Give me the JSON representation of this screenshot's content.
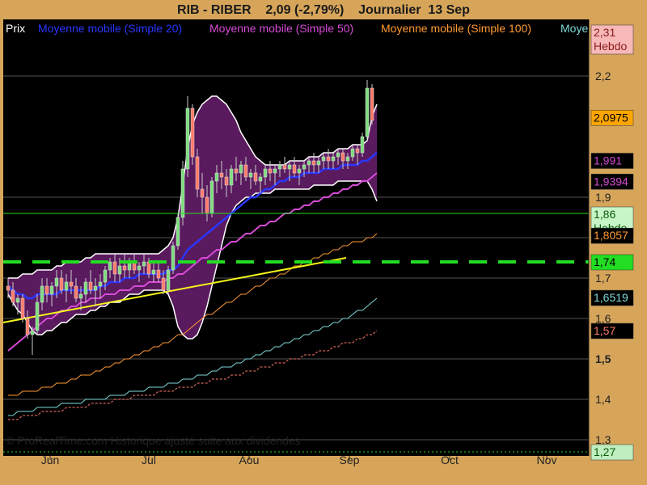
{
  "header": {
    "title": "RIB - RIBER    2,09 (-2,79%)    Journalier  13 Sep"
  },
  "legend": [
    {
      "label": "Prix",
      "color": "#ffffff"
    },
    {
      "label": "Moyenne mobile (Simple 20)",
      "color": "#2a36ff"
    },
    {
      "label": "Moyenne mobile (Simple 50)",
      "color": "#d64bd6"
    },
    {
      "label": "Moyenne mobile (Simple 100)",
      "color": "#ff9a33"
    },
    {
      "label": "Moye",
      "color": "#7fd8d8"
    }
  ],
  "footer": {
    "copyright": "© ProRealTime.com Historique ajusté suite aux dividendes"
  },
  "colors": {
    "background": "#000000",
    "frame": "#d6a55a",
    "bollinger_fill": "#5a1a5e",
    "candle_up": "#7fdc7f",
    "candle_down": "#ff7a6a",
    "sma20": "#2a36ff",
    "sma50": "#d64bd6",
    "sma100": "#ff9a33",
    "sma200": "#7fd8d8",
    "trendline": "#f5f51a",
    "support": "#22dd22"
  },
  "chart_data": {
    "type": "candlestick",
    "x_ticks": [
      "Jun",
      "Jul",
      "Aou",
      "Sep",
      "Oct",
      "Nov"
    ],
    "y_ticks": [
      "2,2",
      "1,9",
      "1,8",
      "1,7",
      "1,6",
      "1,5",
      "1,4",
      "1,3"
    ],
    "y_tick_bold": "1,5",
    "ylim": [
      1.26,
      2.34
    ],
    "price_labels": [
      {
        "value": 2.31,
        "text": "2,31\nHebdo",
        "bg": "#f7b8b8",
        "fg": "#8b1a1a"
      },
      {
        "value": 2.0975,
        "text": "2,0975",
        "bg": "#ffa500",
        "fg": "#000000"
      },
      {
        "value": 1.991,
        "text": "1,991",
        "bg": "#000000",
        "fg": "#d64bd6"
      },
      {
        "value": 1.9394,
        "text": "1,9394",
        "bg": "#000000",
        "fg": "#d64bd6"
      },
      {
        "value": 1.86,
        "text": "1,86\nHebdo",
        "bg": "#c8f5c8",
        "fg": "#0b5a0b"
      },
      {
        "value": 1.8057,
        "text": "1,8057",
        "bg": "#000000",
        "fg": "#ff9a33"
      },
      {
        "value": 1.74,
        "text": "1,74",
        "bg": "#22dd22",
        "fg": "#000000"
      },
      {
        "value": 1.6519,
        "text": "1,6519",
        "bg": "#000000",
        "fg": "#7fd8d8"
      },
      {
        "value": 1.57,
        "text": "1,57",
        "bg": "#000000",
        "fg": "#ff7a6a"
      },
      {
        "value": 1.27,
        "text": "1,27",
        "bg": "#bfeec0",
        "fg": "#0b5a0b"
      }
    ],
    "horizontal_lines": [
      {
        "value": 2.31,
        "style": "solid",
        "color": "#ff0000"
      },
      {
        "value": 1.86,
        "style": "solid",
        "color": "#22dd22"
      },
      {
        "value": 1.74,
        "style": "dashed",
        "color": "#22dd22"
      },
      {
        "value": 1.27,
        "style": "dotted",
        "color": "#22dd22"
      }
    ],
    "candles": [
      [
        "o",
        1.68,
        1.7,
        1.65,
        1.67
      ],
      [
        "o",
        1.67,
        1.69,
        1.63,
        1.64
      ],
      [
        "o",
        1.64,
        1.66,
        1.61,
        1.65
      ],
      [
        "o",
        1.65,
        1.66,
        1.59,
        1.6
      ],
      [
        "o",
        1.6,
        1.62,
        1.55,
        1.56
      ],
      [
        "o",
        1.56,
        1.58,
        1.51,
        1.57
      ],
      [
        "o",
        1.57,
        1.66,
        1.56,
        1.64
      ],
      [
        "o",
        1.64,
        1.7,
        1.62,
        1.68
      ],
      [
        "o",
        1.68,
        1.7,
        1.64,
        1.66
      ],
      [
        "o",
        1.66,
        1.69,
        1.63,
        1.68
      ],
      [
        "o",
        1.68,
        1.72,
        1.65,
        1.7
      ],
      [
        "o",
        1.7,
        1.72,
        1.66,
        1.67
      ],
      [
        "o",
        1.67,
        1.71,
        1.64,
        1.69
      ],
      [
        "o",
        1.69,
        1.72,
        1.66,
        1.68
      ],
      [
        "o",
        1.68,
        1.7,
        1.64,
        1.65
      ],
      [
        "o",
        1.65,
        1.68,
        1.62,
        1.66
      ],
      [
        "o",
        1.66,
        1.7,
        1.64,
        1.69
      ],
      [
        "o",
        1.69,
        1.72,
        1.66,
        1.67
      ],
      [
        "o",
        1.67,
        1.7,
        1.63,
        1.68
      ],
      [
        "o",
        1.68,
        1.71,
        1.65,
        1.69
      ],
      [
        "o",
        1.69,
        1.73,
        1.67,
        1.72
      ],
      [
        "o",
        1.72,
        1.75,
        1.7,
        1.74
      ],
      [
        "o",
        1.74,
        1.76,
        1.69,
        1.71
      ],
      [
        "o",
        1.71,
        1.75,
        1.69,
        1.73
      ],
      [
        "o",
        1.73,
        1.76,
        1.7,
        1.72
      ],
      [
        "o",
        1.72,
        1.75,
        1.7,
        1.74
      ],
      [
        "o",
        1.74,
        1.76,
        1.71,
        1.72
      ],
      [
        "o",
        1.72,
        1.74,
        1.69,
        1.73
      ],
      [
        "o",
        1.73,
        1.76,
        1.71,
        1.74
      ],
      [
        "o",
        1.74,
        1.75,
        1.7,
        1.71
      ],
      [
        "o",
        1.71,
        1.74,
        1.69,
        1.72
      ],
      [
        "o",
        1.72,
        1.74,
        1.69,
        1.7
      ],
      [
        "o",
        1.7,
        1.72,
        1.66,
        1.67
      ],
      [
        "o",
        1.67,
        1.73,
        1.66,
        1.72
      ],
      [
        "o",
        1.72,
        1.79,
        1.71,
        1.78
      ],
      [
        "o",
        1.78,
        1.86,
        1.77,
        1.85
      ],
      [
        "o",
        1.85,
        1.99,
        1.83,
        1.97
      ],
      [
        "o",
        1.97,
        2.15,
        1.95,
        2.12
      ],
      [
        "o",
        2.12,
        2.13,
        1.98,
        2.0
      ],
      [
        "o",
        2.0,
        2.02,
        1.9,
        1.92
      ],
      [
        "o",
        1.92,
        1.96,
        1.86,
        1.9
      ],
      [
        "o",
        1.9,
        1.93,
        1.84,
        1.86
      ],
      [
        "o",
        1.86,
        1.95,
        1.85,
        1.94
      ],
      [
        "o",
        1.94,
        1.98,
        1.91,
        1.96
      ],
      [
        "o",
        1.96,
        1.99,
        1.92,
        1.95
      ],
      [
        "o",
        1.95,
        1.97,
        1.9,
        1.93
      ],
      [
        "o",
        1.93,
        1.98,
        1.91,
        1.97
      ],
      [
        "o",
        1.97,
        2.0,
        1.94,
        1.96
      ],
      [
        "o",
        1.96,
        1.99,
        1.93,
        1.98
      ],
      [
        "o",
        1.98,
        2.0,
        1.94,
        1.95
      ],
      [
        "o",
        1.95,
        1.97,
        1.92,
        1.96
      ],
      [
        "o",
        1.96,
        1.98,
        1.93,
        1.94
      ],
      [
        "o",
        1.94,
        1.96,
        1.91,
        1.95
      ],
      [
        "o",
        1.95,
        1.98,
        1.93,
        1.97
      ],
      [
        "o",
        1.97,
        1.99,
        1.94,
        1.96
      ],
      [
        "o",
        1.96,
        1.98,
        1.93,
        1.97
      ],
      [
        "o",
        1.97,
        1.99,
        1.95,
        1.98
      ],
      [
        "o",
        1.98,
        2.0,
        1.96,
        1.97
      ],
      [
        "o",
        1.97,
        1.99,
        1.94,
        1.98
      ],
      [
        "o",
        1.98,
        2.0,
        1.95,
        1.96
      ],
      [
        "o",
        1.96,
        1.98,
        1.93,
        1.97
      ],
      [
        "o",
        1.97,
        1.99,
        1.95,
        1.98
      ],
      [
        "o",
        1.98,
        2.0,
        1.96,
        1.99
      ],
      [
        "o",
        1.99,
        2.01,
        1.96,
        1.98
      ],
      [
        "o",
        1.98,
        2.0,
        1.96,
        1.99
      ],
      [
        "o",
        1.99,
        2.01,
        1.97,
        2.0
      ],
      [
        "o",
        2.0,
        2.02,
        1.97,
        1.99
      ],
      [
        "o",
        1.99,
        2.01,
        1.97,
        2.0
      ],
      [
        "o",
        2.0,
        2.02,
        1.98,
        2.01
      ],
      [
        "o",
        2.01,
        2.02,
        1.97,
        1.99
      ],
      [
        "o",
        1.99,
        2.01,
        1.97,
        2.0
      ],
      [
        "o",
        2.0,
        2.03,
        1.99,
        2.02
      ],
      [
        "o",
        2.02,
        2.03,
        1.98,
        2.01
      ],
      [
        "o",
        2.01,
        2.06,
        2.0,
        2.05
      ],
      [
        "o",
        2.05,
        2.19,
        2.04,
        2.17
      ],
      [
        "o",
        2.17,
        2.18,
        2.08,
        2.09
      ]
    ],
    "series": [
      {
        "name": "Moyenne mobile (Simple 20)",
        "values": [
          1.68,
          1.67,
          1.66,
          1.66,
          1.65,
          1.65,
          1.66,
          1.66,
          1.66,
          1.66,
          1.66,
          1.67,
          1.67,
          1.67,
          1.67,
          1.67,
          1.67,
          1.67,
          1.67,
          1.68,
          1.68,
          1.69,
          1.69,
          1.69,
          1.7,
          1.7,
          1.7,
          1.71,
          1.71,
          1.71,
          1.71,
          1.71,
          1.71,
          1.72,
          1.72,
          1.73,
          1.75,
          1.77,
          1.78,
          1.79,
          1.8,
          1.81,
          1.82,
          1.83,
          1.84,
          1.85,
          1.86,
          1.87,
          1.88,
          1.89,
          1.9,
          1.9,
          1.91,
          1.92,
          1.92,
          1.93,
          1.94,
          1.94,
          1.95,
          1.95,
          1.95,
          1.96,
          1.96,
          1.96,
          1.96,
          1.97,
          1.97,
          1.97,
          1.97,
          1.98,
          1.98,
          1.98,
          1.98,
          1.99,
          1.99,
          2.0,
          2.01
        ]
      },
      {
        "name": "Moyenne mobile (Simple 50)",
        "values": [
          1.52,
          1.53,
          1.54,
          1.55,
          1.56,
          1.57,
          1.58,
          1.59,
          1.6,
          1.6,
          1.61,
          1.62,
          1.62,
          1.63,
          1.63,
          1.64,
          1.64,
          1.65,
          1.65,
          1.65,
          1.66,
          1.66,
          1.66,
          1.67,
          1.67,
          1.67,
          1.68,
          1.68,
          1.68,
          1.69,
          1.69,
          1.69,
          1.69,
          1.7,
          1.7,
          1.71,
          1.71,
          1.72,
          1.73,
          1.74,
          1.75,
          1.75,
          1.76,
          1.77,
          1.77,
          1.78,
          1.79,
          1.79,
          1.8,
          1.81,
          1.81,
          1.82,
          1.83,
          1.83,
          1.84,
          1.84,
          1.85,
          1.86,
          1.86,
          1.87,
          1.87,
          1.88,
          1.88,
          1.89,
          1.89,
          1.9,
          1.9,
          1.91,
          1.91,
          1.92,
          1.92,
          1.93,
          1.93,
          1.94,
          1.94,
          1.95,
          1.96
        ]
      },
      {
        "name": "Moyenne mobile (Simple 100)",
        "values": [
          1.41,
          1.41,
          1.41,
          1.42,
          1.42,
          1.42,
          1.42,
          1.43,
          1.43,
          1.43,
          1.44,
          1.44,
          1.44,
          1.45,
          1.45,
          1.46,
          1.46,
          1.46,
          1.47,
          1.47,
          1.48,
          1.48,
          1.49,
          1.49,
          1.5,
          1.5,
          1.51,
          1.51,
          1.52,
          1.52,
          1.53,
          1.53,
          1.54,
          1.54,
          1.55,
          1.56,
          1.56,
          1.57,
          1.58,
          1.59,
          1.6,
          1.61,
          1.61,
          1.62,
          1.63,
          1.64,
          1.64,
          1.65,
          1.66,
          1.66,
          1.67,
          1.68,
          1.68,
          1.69,
          1.7,
          1.7,
          1.71,
          1.71,
          1.72,
          1.73,
          1.73,
          1.74,
          1.74,
          1.75,
          1.75,
          1.76,
          1.76,
          1.77,
          1.77,
          1.78,
          1.78,
          1.79,
          1.79,
          1.79,
          1.8,
          1.8,
          1.81
        ]
      },
      {
        "name": "Moye",
        "values": [
          1.36,
          1.36,
          1.37,
          1.37,
          1.37,
          1.37,
          1.38,
          1.38,
          1.38,
          1.38,
          1.38,
          1.39,
          1.39,
          1.39,
          1.39,
          1.39,
          1.4,
          1.4,
          1.4,
          1.4,
          1.4,
          1.41,
          1.41,
          1.41,
          1.41,
          1.42,
          1.42,
          1.42,
          1.42,
          1.43,
          1.43,
          1.43,
          1.43,
          1.44,
          1.44,
          1.44,
          1.45,
          1.45,
          1.45,
          1.46,
          1.46,
          1.46,
          1.47,
          1.47,
          1.48,
          1.48,
          1.48,
          1.49,
          1.49,
          1.5,
          1.5,
          1.51,
          1.51,
          1.52,
          1.52,
          1.53,
          1.53,
          1.54,
          1.54,
          1.55,
          1.55,
          1.56,
          1.56,
          1.57,
          1.57,
          1.58,
          1.58,
          1.59,
          1.59,
          1.6,
          1.6,
          1.61,
          1.62,
          1.62,
          1.63,
          1.64,
          1.65
        ]
      },
      {
        "values": [
          1.35,
          1.35,
          1.35,
          1.36,
          1.36,
          1.36,
          1.36,
          1.37,
          1.37,
          1.37,
          1.37,
          1.37,
          1.38,
          1.38,
          1.38,
          1.38,
          1.38,
          1.39,
          1.39,
          1.39,
          1.39,
          1.39,
          1.4,
          1.4,
          1.4,
          1.4,
          1.41,
          1.41,
          1.41,
          1.41,
          1.41,
          1.42,
          1.42,
          1.42,
          1.42,
          1.43,
          1.43,
          1.43,
          1.43,
          1.44,
          1.44,
          1.44,
          1.45,
          1.45,
          1.45,
          1.45,
          1.46,
          1.46,
          1.46,
          1.47,
          1.47,
          1.47,
          1.48,
          1.48,
          1.48,
          1.49,
          1.49,
          1.49,
          1.5,
          1.5,
          1.5,
          1.51,
          1.51,
          1.51,
          1.52,
          1.52,
          1.52,
          1.53,
          1.53,
          1.54,
          1.54,
          1.54,
          1.55,
          1.55,
          1.56,
          1.56,
          1.57
        ]
      }
    ],
    "bollinger_upper": [
      1.7,
      1.7,
      1.7,
      1.71,
      1.71,
      1.71,
      1.72,
      1.72,
      1.72,
      1.72,
      1.73,
      1.73,
      1.74,
      1.74,
      1.74,
      1.74,
      1.75,
      1.75,
      1.76,
      1.76,
      1.76,
      1.76,
      1.76,
      1.76,
      1.76,
      1.76,
      1.76,
      1.76,
      1.76,
      1.76,
      1.76,
      1.76,
      1.77,
      1.78,
      1.8,
      1.85,
      1.93,
      2.02,
      2.08,
      2.11,
      2.13,
      2.14,
      2.15,
      2.15,
      2.14,
      2.13,
      2.11,
      2.09,
      2.06,
      2.04,
      2.02,
      2.0,
      1.99,
      1.98,
      1.98,
      1.98,
      1.98,
      1.98,
      1.99,
      1.99,
      1.99,
      1.99,
      2.0,
      2.0,
      2.0,
      2.01,
      2.01,
      2.01,
      2.02,
      2.02,
      2.02,
      2.03,
      2.03,
      2.03,
      2.04,
      2.1,
      2.13
    ],
    "bollinger_lower": [
      1.66,
      1.64,
      1.62,
      1.61,
      1.59,
      1.57,
      1.56,
      1.56,
      1.57,
      1.57,
      1.58,
      1.59,
      1.59,
      1.6,
      1.61,
      1.61,
      1.61,
      1.62,
      1.62,
      1.63,
      1.63,
      1.64,
      1.64,
      1.64,
      1.65,
      1.66,
      1.66,
      1.66,
      1.67,
      1.67,
      1.67,
      1.67,
      1.67,
      1.66,
      1.63,
      1.58,
      1.56,
      1.55,
      1.55,
      1.56,
      1.59,
      1.63,
      1.68,
      1.73,
      1.78,
      1.83,
      1.86,
      1.88,
      1.89,
      1.9,
      1.9,
      1.91,
      1.91,
      1.91,
      1.91,
      1.92,
      1.92,
      1.92,
      1.92,
      1.92,
      1.92,
      1.92,
      1.92,
      1.93,
      1.93,
      1.93,
      1.93,
      1.93,
      1.94,
      1.94,
      1.94,
      1.94,
      1.94,
      1.94,
      1.94,
      1.92,
      1.89
    ],
    "trendline": [
      1.59,
      1.75
    ],
    "support_level": 1.74,
    "resistance_level": 2.31,
    "weekly_level": 1.86,
    "low_level": 1.27
  }
}
